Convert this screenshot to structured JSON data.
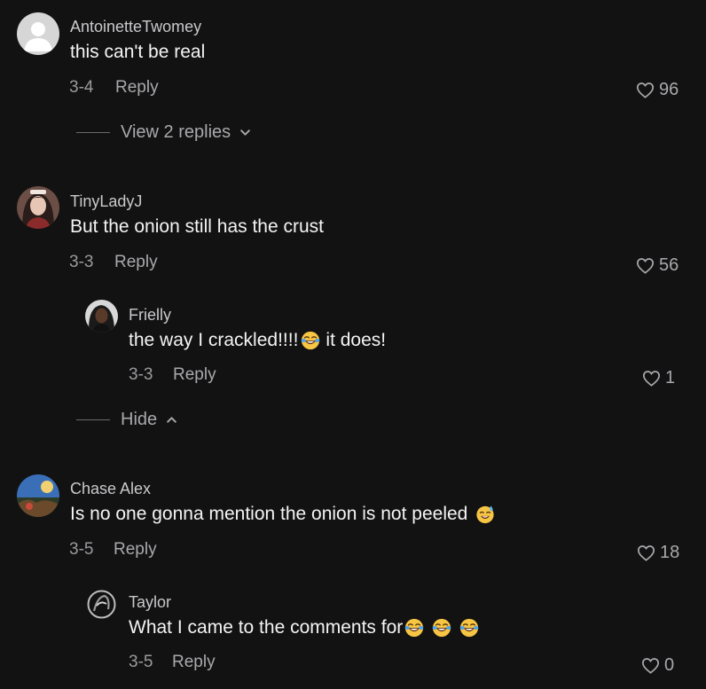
{
  "comments": [
    {
      "username": "AntoinetteTwomey",
      "text": "this can't be real",
      "date": "3-4",
      "reply_label": "Reply",
      "likes": "96",
      "toggle_label": "View 2 replies"
    },
    {
      "username": "TinyLadyJ",
      "text": "But the onion still has the crust",
      "date": "3-3",
      "reply_label": "Reply",
      "likes": "56",
      "replies": [
        {
          "username": "Frielly",
          "text_before": "the way I crackled!!!!",
          "emoji": "laughing-crying-emoji",
          "text_after": "it does!",
          "date": "3-3",
          "reply_label": "Reply",
          "likes": "1"
        }
      ],
      "toggle_label": "Hide"
    },
    {
      "username": "Chase Alex",
      "text": "Is no one gonna mention the onion is not peeled",
      "emoji": "sweat-smile-emoji",
      "date": "3-5",
      "reply_label": "Reply",
      "likes": "18",
      "replies": [
        {
          "username": "Taylor",
          "text": "What I came to the comments for",
          "emojis": [
            "laughing-crying-emoji",
            "laughing-crying-emoji",
            "laughing-crying-emoji"
          ],
          "date": "3-5",
          "reply_label": "Reply",
          "likes": "0"
        }
      ]
    }
  ],
  "colors": {
    "background": "#121212",
    "primary_text": "#f4f4f4",
    "secondary_text": "#a9a9ad"
  }
}
